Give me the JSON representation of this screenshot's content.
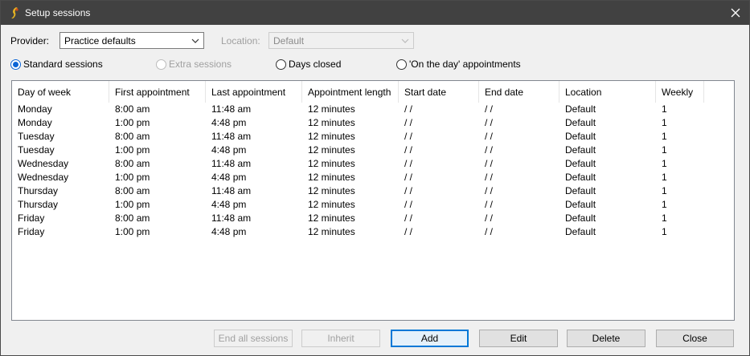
{
  "window": {
    "title": "Setup sessions"
  },
  "provider": {
    "label": "Provider:",
    "value": "Practice defaults"
  },
  "location": {
    "label": "Location:",
    "value": "Default"
  },
  "session_types": [
    {
      "label": "Standard sessions",
      "selected": true,
      "enabled": true
    },
    {
      "label": "Extra sessions",
      "selected": false,
      "enabled": false
    },
    {
      "label": "Days closed",
      "selected": false,
      "enabled": true
    },
    {
      "label": "'On the day' appointments",
      "selected": false,
      "enabled": true
    }
  ],
  "table": {
    "columns": [
      "Day of week",
      "First appointment",
      "Last appointment",
      "Appointment length",
      "Start date",
      "End date",
      "Location",
      "Weekly"
    ],
    "rows": [
      [
        "Monday",
        "8:00 am",
        "11:48 am",
        "12 minutes",
        " /  /",
        " /  /",
        "Default",
        "1"
      ],
      [
        "Monday",
        "1:00 pm",
        "4:48 pm",
        "12 minutes",
        " /  /",
        " /  /",
        "Default",
        "1"
      ],
      [
        "Tuesday",
        "8:00 am",
        "11:48 am",
        "12 minutes",
        " /  /",
        " /  /",
        "Default",
        "1"
      ],
      [
        "Tuesday",
        "1:00 pm",
        "4:48 pm",
        "12 minutes",
        " /  /",
        " /  /",
        "Default",
        "1"
      ],
      [
        "Wednesday",
        "8:00 am",
        "11:48 am",
        "12 minutes",
        " /  /",
        " /  /",
        "Default",
        "1"
      ],
      [
        "Wednesday",
        "1:00 pm",
        "4:48 pm",
        "12 minutes",
        " /  /",
        " /  /",
        "Default",
        "1"
      ],
      [
        "Thursday",
        "8:00 am",
        "11:48 am",
        "12 minutes",
        " /  /",
        " /  /",
        "Default",
        "1"
      ],
      [
        "Thursday",
        "1:00 pm",
        "4:48 pm",
        "12 minutes",
        " /  /",
        " /  /",
        "Default",
        "1"
      ],
      [
        "Friday",
        "8:00 am",
        "11:48 am",
        "12 minutes",
        " /  /",
        " /  /",
        "Default",
        "1"
      ],
      [
        "Friday",
        "1:00 pm",
        "4:48 pm",
        "12 minutes",
        " /  /",
        " /  /",
        "Default",
        "1"
      ]
    ]
  },
  "buttons": {
    "end_all": "End all sessions",
    "inherit": "Inherit",
    "add": "Add",
    "edit": "Edit",
    "delete": "Delete",
    "close": "Close"
  },
  "colors": {
    "titlebar": "#414141",
    "accent": "#0a64d6"
  }
}
